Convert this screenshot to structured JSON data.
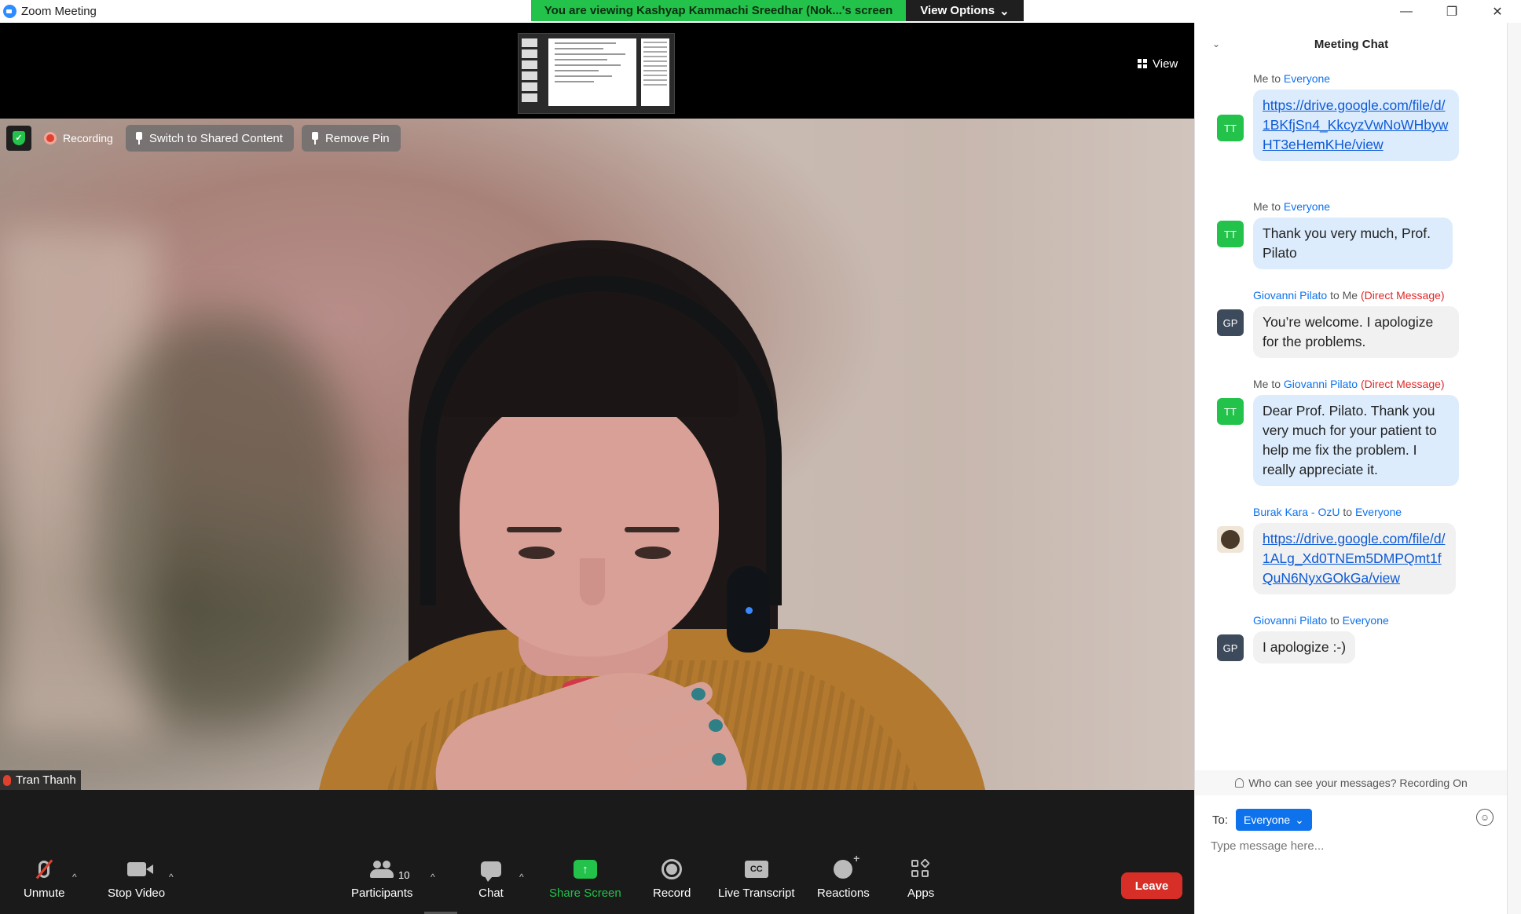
{
  "window": {
    "title": "Zoom Meeting",
    "controls": {
      "minimize": "—",
      "restore": "❐",
      "close": "✕"
    }
  },
  "share_banner": {
    "text": "You are viewing Kashyap Kammachi Sreedhar (Nok...'s screen",
    "view_options": "View Options"
  },
  "view_button": "View",
  "video": {
    "recording_label": "Recording",
    "switch_button": "Switch to Shared Content",
    "remove_pin_button": "Remove Pin",
    "participant_name": "Tran Thanh"
  },
  "toolbar": {
    "unmute": "Unmute",
    "stop_video": "Stop Video",
    "participants": "Participants",
    "participants_count": "10",
    "chat": "Chat",
    "share_screen": "Share Screen",
    "record": "Record",
    "live_transcript": "Live Transcript",
    "cc_text": "CC",
    "reactions": "Reactions",
    "apps": "Apps",
    "leave": "Leave"
  },
  "chat": {
    "title": "Meeting Chat",
    "messages": [
      {
        "from": "Me",
        "to_word": "to",
        "to": "Everyone",
        "dm": "",
        "avatar": "TT",
        "text": "https://drive.google.com/file/d/1BKfjSn4_KkcyzVwNoWHbywHT3eHemKHe/view"
      },
      {
        "from": "Me",
        "to_word": "to",
        "to": "Everyone",
        "dm": "",
        "avatar": "TT",
        "text": "Thank you very much, Prof. Pilato"
      },
      {
        "from": "Giovanni Pilato",
        "to_word": "to",
        "to": "Me",
        "dm": "(Direct Message)",
        "avatar": "GP",
        "text": "You’re welcome. I apologize for the problems."
      },
      {
        "from": "Me",
        "to_word": "to",
        "to": "Giovanni Pilato",
        "dm": "(Direct Message)",
        "avatar": "TT",
        "text": "Dear Prof. Pilato. Thank you very much for your patient to help me fix the problem. I really appreciate it."
      },
      {
        "from": "Burak Kara - OzU",
        "to_word": "to",
        "to": "Everyone",
        "dm": "",
        "avatar": "",
        "text": "https://drive.google.com/file/d/1ALg_Xd0TNEm5DMPQmt1fQuN6NyxGOkGa/view"
      },
      {
        "from": "Giovanni Pilato",
        "to_word": "to",
        "to": "Everyone",
        "dm": "",
        "avatar": "GP",
        "text": "I apologize :-)"
      }
    ],
    "privacy_text": "Who can see your messages? Recording On",
    "to_label": "To:",
    "recipient": "Everyone",
    "input_placeholder": "Type message here..."
  },
  "colors": {
    "share_green": "#23c24a",
    "zoom_blue": "#0e72ed",
    "leave_red": "#d72e27",
    "dm_red": "#e02828"
  }
}
